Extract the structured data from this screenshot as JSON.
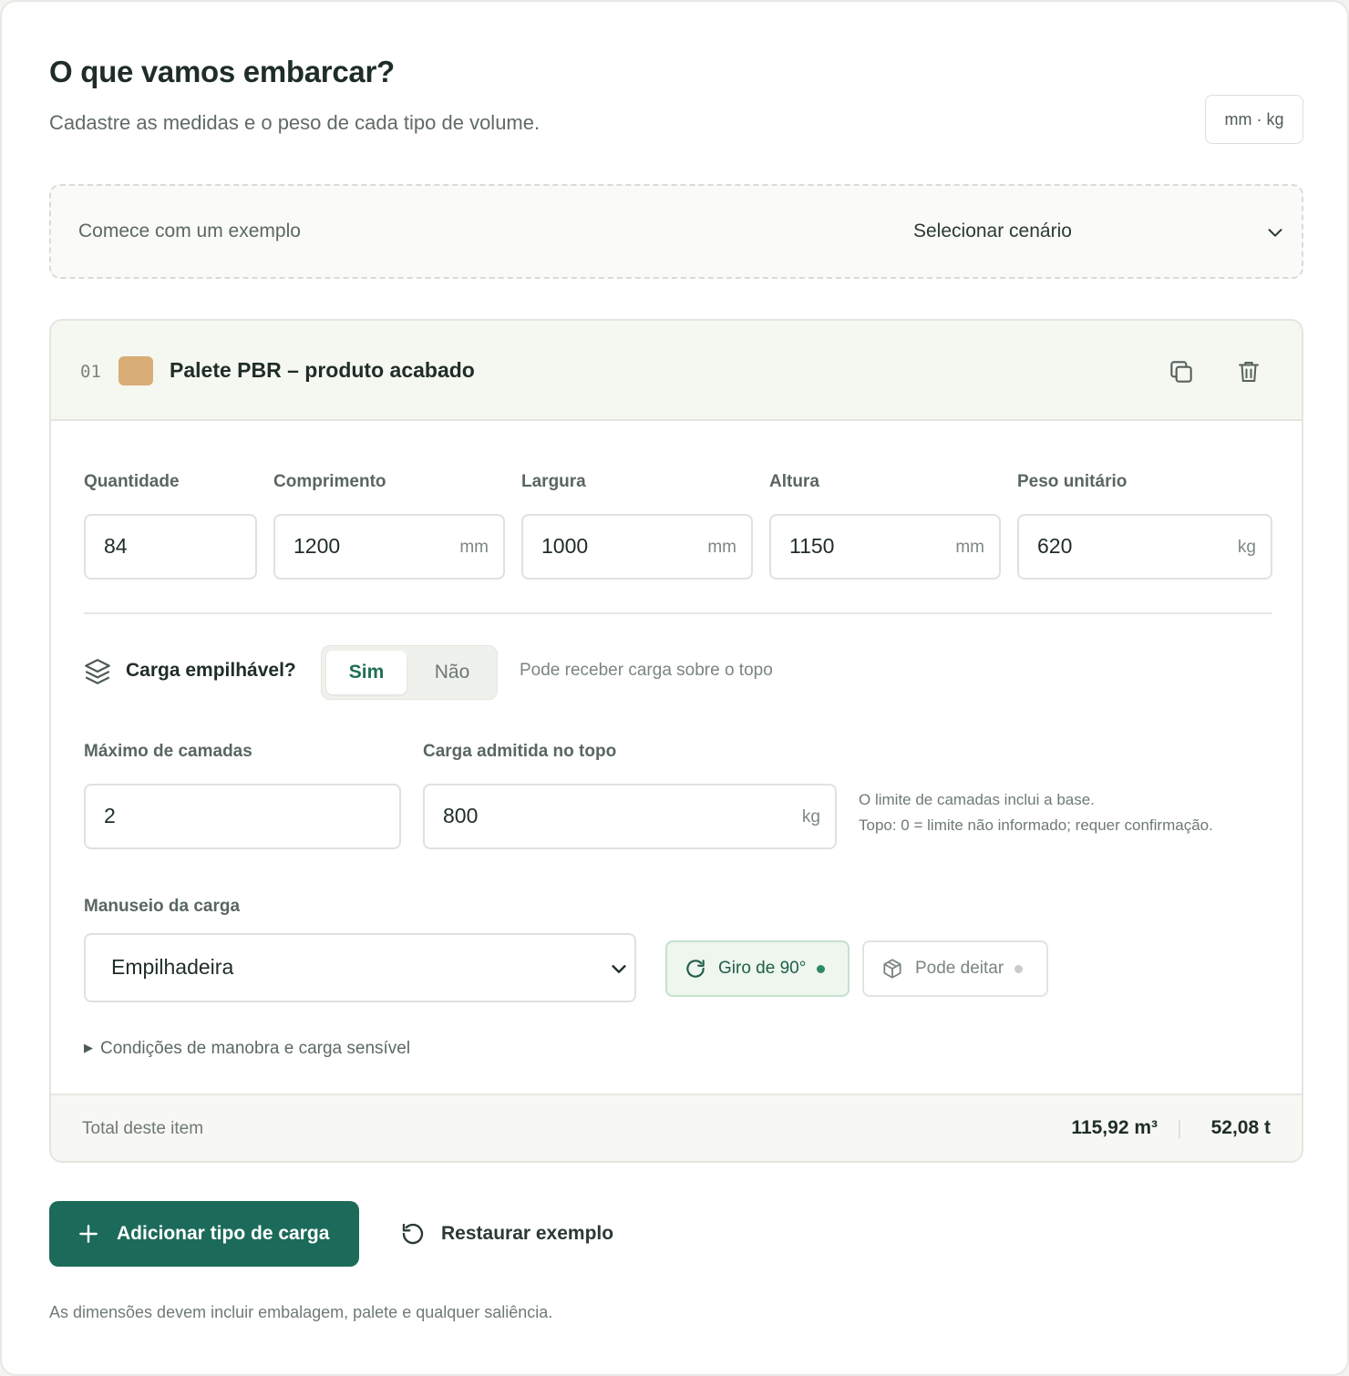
{
  "header": {
    "title": "O que vamos embarcar?",
    "subtitle": "Cadastre as medidas e o peso de cada tipo de volume.",
    "units_badge": "mm · kg"
  },
  "example": {
    "label": "Comece com um exemplo",
    "select_value": "Selecionar cenário",
    "icon": "chevron-down-icon"
  },
  "item": {
    "index": "01",
    "color": "#d9ad76",
    "name": "Palete PBR – produto acabado",
    "actions": {
      "duplicate_icon": "copy-icon",
      "delete_icon": "trash-icon"
    },
    "fields": {
      "quantidade": {
        "label": "Quantidade",
        "value": "84"
      },
      "comprimento": {
        "label": "Comprimento",
        "value": "1200",
        "unit": "mm"
      },
      "largura": {
        "label": "Largura",
        "value": "1000",
        "unit": "mm"
      },
      "altura": {
        "label": "Altura",
        "value": "1150",
        "unit": "mm"
      },
      "peso": {
        "label": "Peso unitário",
        "value": "620",
        "unit": "kg"
      }
    },
    "stackable": {
      "icon": "layers-icon",
      "label": "Carga empilhável?",
      "yes": "Sim",
      "no": "Não",
      "selected": "Sim",
      "hint": "Pode receber carga sobre o topo"
    },
    "layers": {
      "label": "Máximo de camadas",
      "value": "2"
    },
    "top_load": {
      "label": "Carga admitida no topo",
      "value": "800",
      "unit": "kg"
    },
    "notes": {
      "line1": "O limite de camadas inclui a base.",
      "line2": "Topo: 0 = limite não informado; requer confirmação."
    },
    "handling": {
      "label": "Manuseio da carga",
      "value": "Empilhadeira",
      "chips": {
        "rotate": {
          "label": "Giro de 90°",
          "active": true,
          "icon": "rotate-icon",
          "dot_color": "#2e8a63"
        },
        "lay_down": {
          "label": "Pode deitar",
          "active": false,
          "icon": "box-icon",
          "dot_color": "#c9cdc7"
        }
      }
    },
    "disclosure": "Condições de manobra e carga sensível",
    "footer": {
      "label": "Total deste item",
      "volume": "115,92 m³",
      "weight": "52,08 t"
    }
  },
  "actions": {
    "add_label": "Adicionar tipo de carga",
    "restore_label": "Restaurar exemplo"
  },
  "footnote": "As dimensões devem incluir embalagem, palete e qualquer saliência.",
  "colors": {
    "primary": "#1c6b5a",
    "accent_text": "#1f6e55"
  }
}
